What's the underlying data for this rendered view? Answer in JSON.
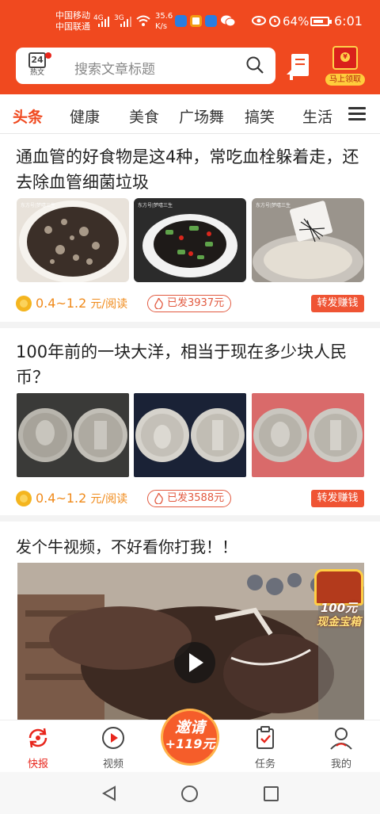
{
  "status_bar": {
    "carrier1": "中国移动",
    "carrier2": "中国联通",
    "net1": "4G",
    "net2": "3G",
    "speed_value": "35.6",
    "speed_unit": "K/s",
    "battery": "64%",
    "time": "6:01"
  },
  "header": {
    "logo_number": "24",
    "logo_label": "热文",
    "search_placeholder": "搜索文章标题",
    "red_packet_label": "马上领取",
    "red_packet_symbol": "¥"
  },
  "tabs": [
    "头条",
    "健康",
    "美食",
    "广场舞",
    "搞笑",
    "生活"
  ],
  "active_tab": 0,
  "articles": [
    {
      "title": "通血管的好食物是这4种，常吃血栓躲着走，还去除血管细菌垃圾",
      "reward": "0.4~1.2",
      "reward_unit": "元/阅读",
      "shared": "已发3937元",
      "forward": "转发赚钱",
      "watermark": "东方号|梦嘻三生"
    },
    {
      "title": "100年前的一块大洋，相当于现在多少块人民币？",
      "reward": "0.4~1.2",
      "reward_unit": "元/阅读",
      "shared": "已发3588元",
      "forward": "转发赚钱"
    }
  ],
  "video": {
    "title": "发个牛视频，不好看你打我！！",
    "treasure_amount": "100元",
    "treasure_label": "现金宝箱"
  },
  "bottom_nav": [
    {
      "label": "快报",
      "icon": "refresh-icon"
    },
    {
      "label": "视频",
      "icon": "play-circle-icon"
    },
    {
      "label": "任务",
      "icon": "clipboard-check-icon"
    },
    {
      "label": "我的",
      "icon": "user-icon"
    }
  ],
  "invite": {
    "line1": "邀请",
    "line2": "+119元"
  },
  "colors": {
    "brand": "#f0491f",
    "reward": "#f08a1a",
    "forward_button": "#ef5434"
  }
}
